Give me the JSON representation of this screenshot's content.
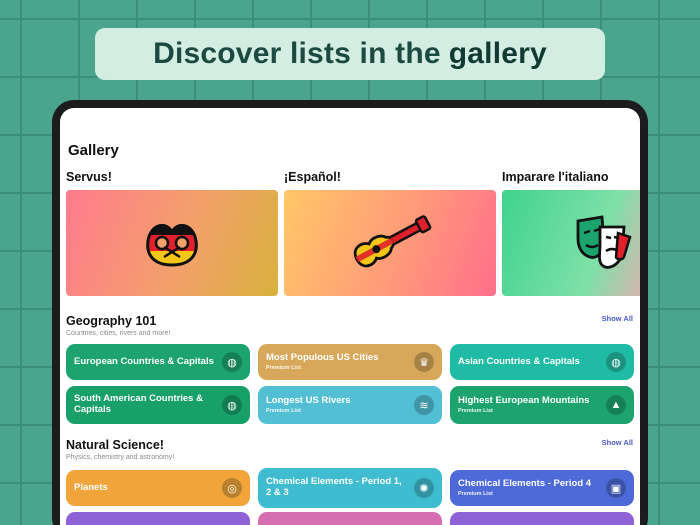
{
  "banner": {
    "text_regular": "Discover lists in the",
    "text_bold": "gallery"
  },
  "page": {
    "title": "Gallery"
  },
  "carousel": [
    {
      "title": "Servus!",
      "icon": "pretzel-icon"
    },
    {
      "title": "¡Español!",
      "icon": "guitar-icon"
    },
    {
      "title": "Imparare l'italiano",
      "icon": "theater-masks-icon"
    }
  ],
  "sections": {
    "geography": {
      "title": "Geography 101",
      "subtitle": "Countries, cities, rivers and more!",
      "show_all": "Show All",
      "items": [
        {
          "label": "European Countries & Capitals",
          "sub": "",
          "icon": "globe-icon"
        },
        {
          "label": "Most Populous US Cities",
          "sub": "Premium List",
          "icon": "crown-icon"
        },
        {
          "label": "Asian Countries & Capitals",
          "sub": "",
          "icon": "globe-icon"
        },
        {
          "label": "South American Countries & Capitals",
          "sub": "",
          "icon": "globe-icon"
        },
        {
          "label": "Longest US Rivers",
          "sub": "Premium List",
          "icon": "waves-icon"
        },
        {
          "label": "Highest European Mountains",
          "sub": "Premium List",
          "icon": "mountain-icon"
        }
      ]
    },
    "science": {
      "title": "Natural Science!",
      "subtitle": "Physics, chemistry and astronomy!",
      "show_all": "Show All",
      "items": [
        {
          "label": "Planets",
          "sub": "",
          "icon": "planet-icon"
        },
        {
          "label": "Chemical Elements - Period 1, 2 & 3",
          "sub": "",
          "icon": "atom-icon"
        },
        {
          "label": "Chemical Elements - Period 4",
          "sub": "Premium List",
          "icon": "element-icon"
        }
      ]
    }
  }
}
